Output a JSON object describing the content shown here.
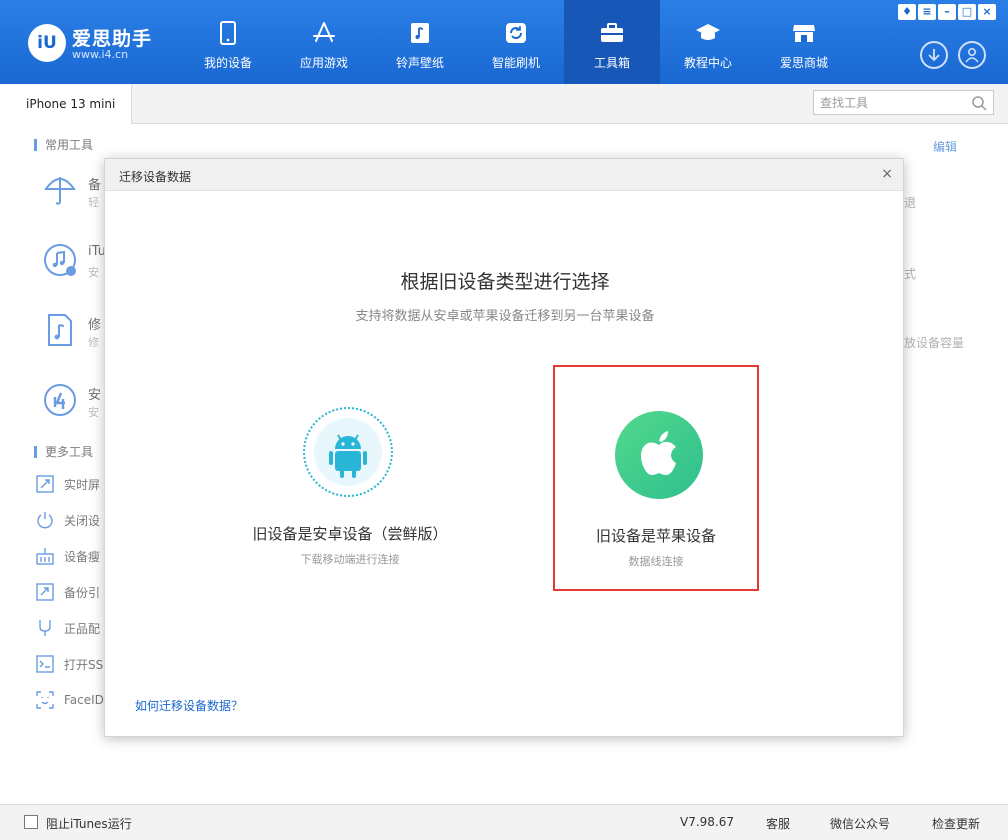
{
  "app": {
    "title": "爱思助手",
    "url": "www.i4.cn",
    "logo_mark": "iU"
  },
  "nav": [
    {
      "label": "我的设备",
      "icon": "phone-icon"
    },
    {
      "label": "应用游戏",
      "icon": "app-store-icon"
    },
    {
      "label": "铃声壁纸",
      "icon": "music-file-icon"
    },
    {
      "label": "智能刷机",
      "icon": "refresh-box-icon"
    },
    {
      "label": "工具箱",
      "icon": "toolbox-icon",
      "active": true
    },
    {
      "label": "教程中心",
      "icon": "graduation-cap-icon"
    },
    {
      "label": "爱思商城",
      "icon": "store-icon"
    }
  ],
  "window_controls": [
    "shirt-icon",
    "menu-icon",
    "minimize-icon",
    "maximize-icon",
    "close-icon"
  ],
  "device_tab": "iPhone 13 mini",
  "search": {
    "placeholder": "查找工具"
  },
  "common_tools": {
    "title": "常用工具",
    "edit": "编辑",
    "items": [
      {
        "title": "备",
        "sub": "轻",
        "icon": "umbrella-icon"
      },
      {
        "title": "iTu",
        "sub": "安",
        "icon": "itunes-icon"
      },
      {
        "title": "修",
        "sub": "修",
        "icon": "music-doc-icon"
      },
      {
        "title": "安",
        "sub": "安",
        "icon": "i4-icon"
      }
    ],
    "right_fragments": [
      "退",
      "式",
      "放设备容量"
    ]
  },
  "more_tools": {
    "title": "更多工具",
    "items": [
      {
        "label": "实时屏",
        "icon": "screen-mirror-icon"
      },
      {
        "label": "关闭设",
        "icon": "power-icon"
      },
      {
        "label": "设备瘦",
        "icon": "broom-icon"
      },
      {
        "label": "备份引",
        "icon": "backup-guide-icon"
      },
      {
        "label": "正品配",
        "icon": "cable-icon"
      },
      {
        "label": "打开SS",
        "icon": "terminal-icon"
      },
      {
        "label": "FaceID",
        "icon": "faceid-icon"
      }
    ]
  },
  "modal": {
    "title": "迁移设备数据",
    "close": "×",
    "heading": "根据旧设备类型进行选择",
    "subheading": "支持将数据从安卓或苹果设备迁移到另一台苹果设备",
    "options": [
      {
        "label": "旧设备是安卓设备（尝鲜版）",
        "sub": "下载移动端进行连接",
        "icon": "android-icon"
      },
      {
        "label": "旧设备是苹果设备",
        "sub": "数据线连接",
        "icon": "apple-icon",
        "selected": true
      }
    ],
    "help_link": "如何迁移设备数据？"
  },
  "statusbar": {
    "block_itunes": "阻止iTunes运行",
    "version": "V7.98.67",
    "service": "客服",
    "wechat": "微信公众号",
    "update": "检查更新"
  },
  "colors": {
    "brand": "#1a68d2",
    "highlight_border": "#e53935",
    "apple_green": "#3ecf8e",
    "android_cyan": "#29b6d6"
  }
}
